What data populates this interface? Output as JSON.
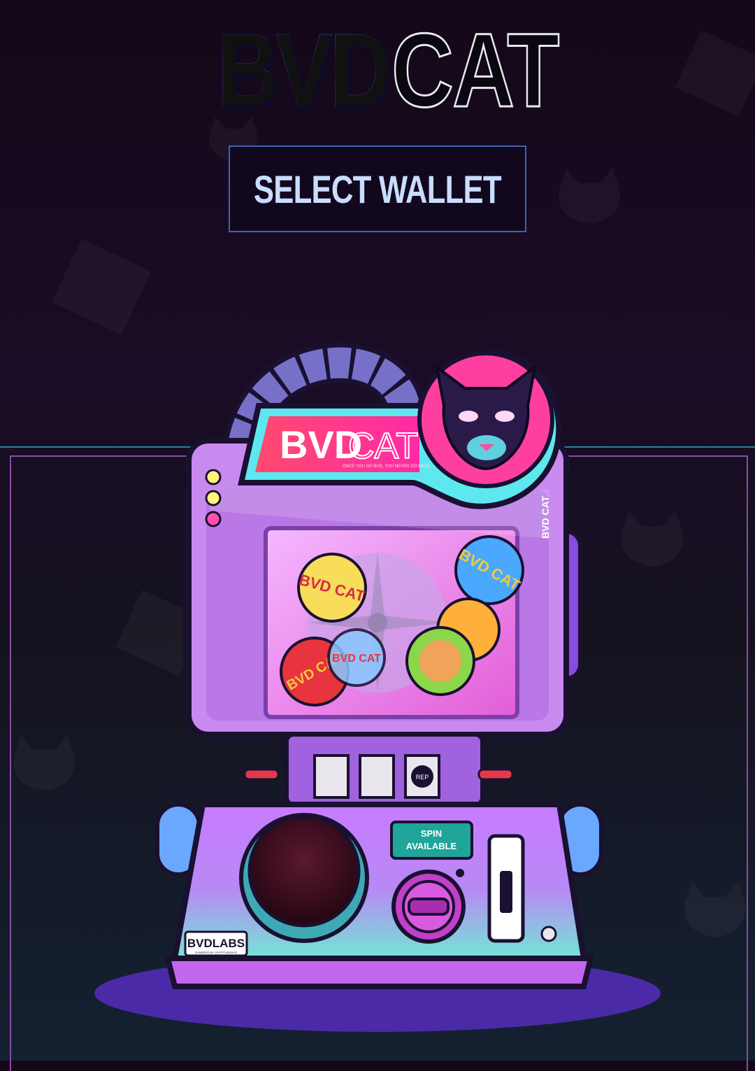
{
  "header": {
    "logo_part1": "BVD",
    "logo_part2": "CAT",
    "wallet_button_label": "SELECT WALLET"
  },
  "machine": {
    "sign_brand": "BVD",
    "sign_brand2": "CAT",
    "sign_tagline": "ONCE YOU GO BVD, YOU NEVER GO BACK.",
    "side_label": "BVD CAT",
    "ball_labels": [
      "BVD CAT",
      "BVD CAT",
      "BVD CAT",
      "BVD CAT"
    ],
    "spin_status_line1": "SPIN",
    "spin_status_line2": "AVAILABLE",
    "window3_label": "REP",
    "footer_brand": "BVDLABS",
    "footer_subtitle": "POWERED BY CRYPTOKIDDOS"
  },
  "colors": {
    "accent_blue": "#3b63b5",
    "button_text": "#c9ddff",
    "machine_purple": "#b06bff",
    "machine_teal": "#6ee6d6",
    "sign_pink": "#ff3fa0"
  }
}
